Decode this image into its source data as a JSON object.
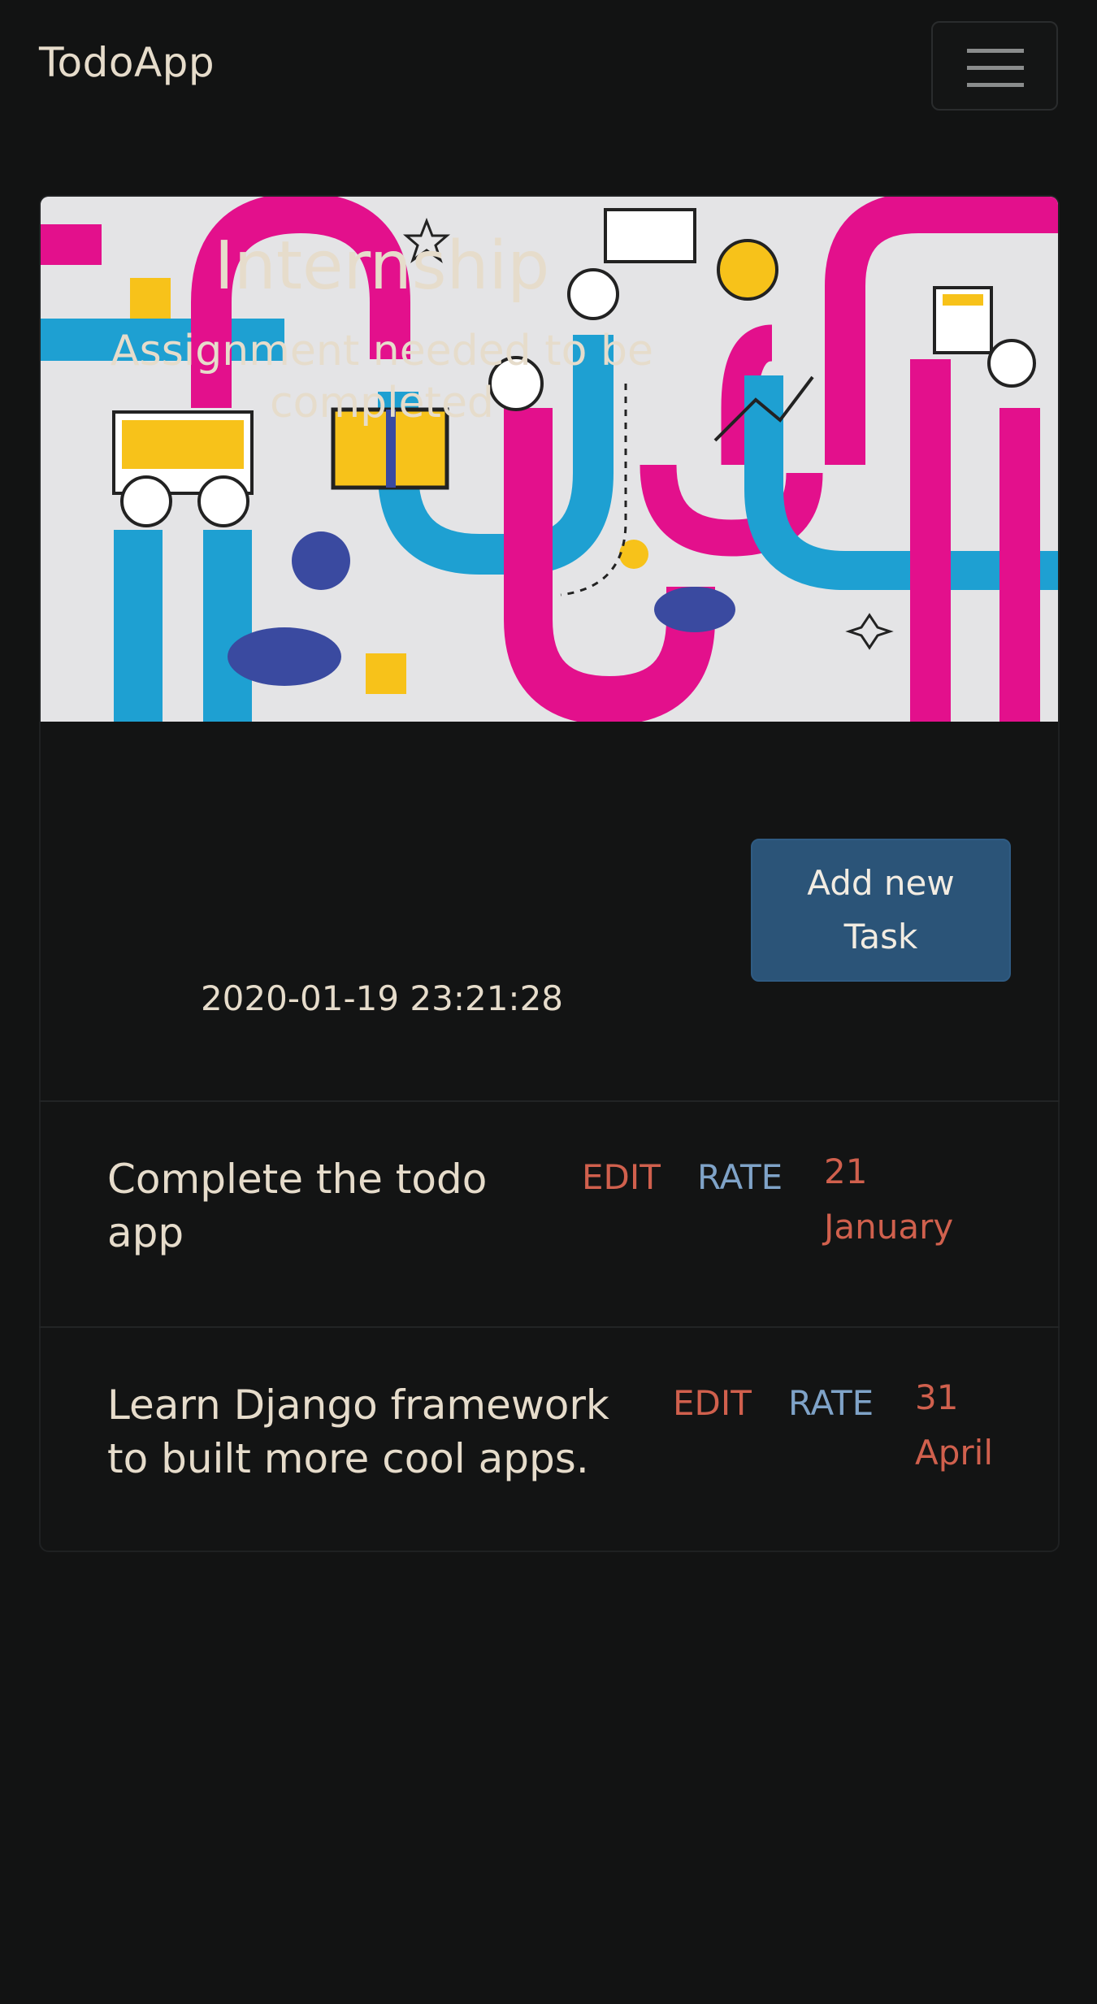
{
  "navbar": {
    "brand": "TodoApp",
    "menu_icon": "hamburger-icon"
  },
  "card": {
    "image_icon": "workflow-illustration",
    "title": "Internship",
    "description": "Assignment needed to be completed",
    "description_lines": [
      "Assignment needed to be",
      "completed"
    ],
    "timestamp": "2020-01-19 23:21:28",
    "add_button_lines": [
      "Add new",
      "Task"
    ]
  },
  "tasks": [
    {
      "text_lines": [
        "Complete the todo",
        "app"
      ],
      "edit_label": "EDIT",
      "rate_label": "RATE",
      "due_day": "21",
      "due_month": "January"
    },
    {
      "text_lines": [
        "Learn Django framework",
        "to built more cool apps."
      ],
      "edit_label": "EDIT",
      "rate_label": "RATE",
      "due_day": "31",
      "due_month": "April"
    }
  ],
  "colors": {
    "background": "#121313",
    "text": "#e6dccb",
    "edit_link": "#d0604d",
    "rate_link": "#7fa3c8",
    "button": "#2b5478",
    "accent_pink": "#e3108c",
    "accent_blue": "#1ea0d2",
    "accent_yellow": "#f7c21a"
  }
}
